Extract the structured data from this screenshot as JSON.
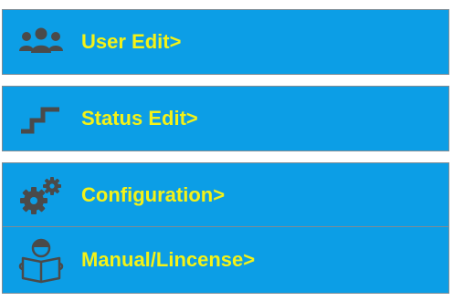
{
  "menu": {
    "items": [
      {
        "label": "User Edit>",
        "icon": "users-icon"
      },
      {
        "label": "Status Edit>",
        "icon": "steps-icon"
      },
      {
        "label": "Configuration>",
        "icon": "gears-icon"
      },
      {
        "label": "Manual/Lincense>",
        "icon": "reader-book-icon"
      }
    ]
  },
  "colors": {
    "button_bg": "#0c9ee6",
    "button_border": "#7d8c96",
    "label_text": "#f4f217",
    "icon_fill": "#4a4a4a"
  }
}
